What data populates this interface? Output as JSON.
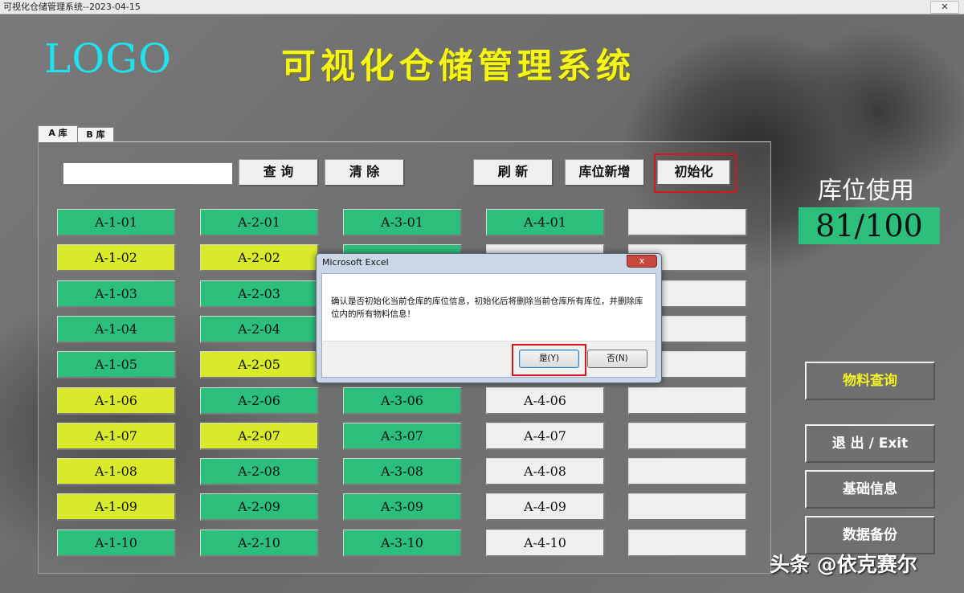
{
  "window": {
    "title": "可视化仓储管理系统--2023-04-15"
  },
  "header": {
    "logo": "LOGO",
    "app_title": "可视化仓储管理系统"
  },
  "tabs": [
    {
      "label": "A 库",
      "active": true
    },
    {
      "label": "B 库",
      "active": false
    }
  ],
  "toolbar": {
    "search_value": "",
    "query_label": "查 询",
    "clear_label": "清 除",
    "refresh_label": "刷 新",
    "add_slot_label": "库位新增",
    "init_label": "初始化"
  },
  "slots": {
    "col1": [
      {
        "label": "A-1-01",
        "status": "green"
      },
      {
        "label": "A-1-02",
        "status": "yellow"
      },
      {
        "label": "A-1-03",
        "status": "green"
      },
      {
        "label": "A-1-04",
        "status": "green"
      },
      {
        "label": "A-1-05",
        "status": "green"
      },
      {
        "label": "A-1-06",
        "status": "yellow"
      },
      {
        "label": "A-1-07",
        "status": "yellow"
      },
      {
        "label": "A-1-08",
        "status": "yellow"
      },
      {
        "label": "A-1-09",
        "status": "yellow"
      },
      {
        "label": "A-1-10",
        "status": "green"
      }
    ],
    "col2": [
      {
        "label": "A-2-01",
        "status": "green"
      },
      {
        "label": "A-2-02",
        "status": "yellow"
      },
      {
        "label": "A-2-03",
        "status": "green"
      },
      {
        "label": "A-2-04",
        "status": "green"
      },
      {
        "label": "A-2-05",
        "status": "yellow"
      },
      {
        "label": "A-2-06",
        "status": "green"
      },
      {
        "label": "A-2-07",
        "status": "yellow"
      },
      {
        "label": "A-2-08",
        "status": "green"
      },
      {
        "label": "A-2-09",
        "status": "green"
      },
      {
        "label": "A-2-10",
        "status": "green"
      }
    ],
    "col3": [
      {
        "label": "A-3-01",
        "status": "green"
      },
      {
        "label": "A-3-06",
        "status": "green"
      },
      {
        "label": "A-3-07",
        "status": "green"
      },
      {
        "label": "A-3-08",
        "status": "green"
      },
      {
        "label": "A-3-09",
        "status": "green"
      },
      {
        "label": "A-3-10",
        "status": "green"
      }
    ],
    "col4": [
      {
        "label": "A-4-01",
        "status": "green"
      },
      {
        "label": "A-4-06",
        "status": "empty"
      },
      {
        "label": "A-4-07",
        "status": "empty"
      },
      {
        "label": "A-4-08",
        "status": "empty"
      },
      {
        "label": "A-4-09",
        "status": "empty"
      },
      {
        "label": "A-4-10",
        "status": "empty"
      }
    ]
  },
  "usage": {
    "label": "库位使用",
    "value": "81/100"
  },
  "side_buttons": {
    "material_query": "物料查询",
    "exit": "退 出 / Exit",
    "basic_info": "基础信息",
    "backup": "数据备份"
  },
  "dialog": {
    "title": "Microsoft Excel",
    "close": "x",
    "message": "确认是否初始化当前仓库的库位信息，初始化后将删除当前仓库所有库位，并删除库位内的所有物料信息！",
    "yes_label": "是(Y)",
    "no_label": "否(N)"
  },
  "watermark": "头条 @依克赛尔",
  "colors": {
    "occupied": "#2bbf7b",
    "partial": "#d8ea2a",
    "empty": "#efefef",
    "highlight": "#d6161a"
  }
}
